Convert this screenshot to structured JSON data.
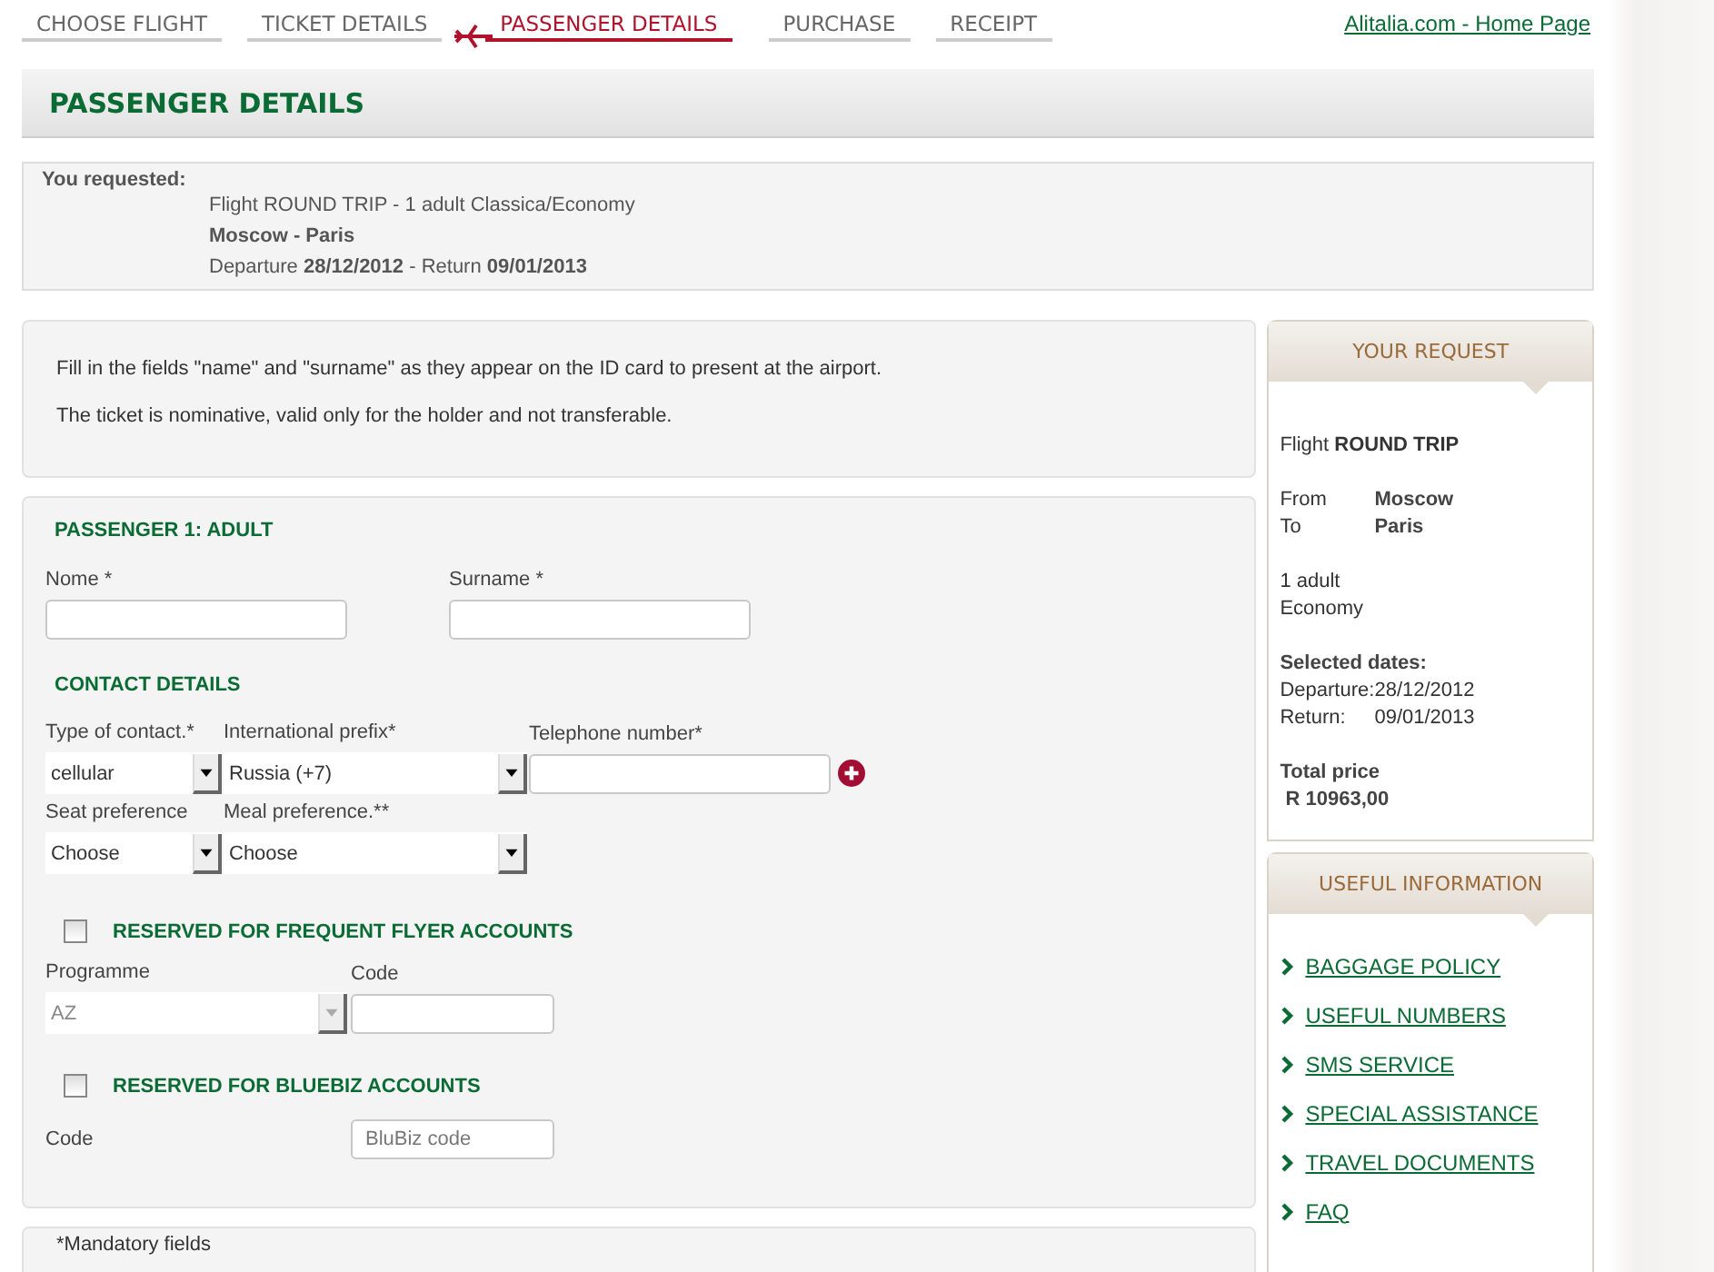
{
  "steps": [
    {
      "label": "CHOOSE FLIGHT",
      "selected": false
    },
    {
      "label": "TICKET DETAILS",
      "selected": false
    },
    {
      "label": "PASSENGER DETAILS",
      "selected": true
    },
    {
      "label": "PURCHASE",
      "selected": false
    },
    {
      "label": "RECEIPT",
      "selected": false
    }
  ],
  "home_link": "Alitalia.com - Home Page",
  "page_title": "PASSENGER DETAILS",
  "request_summary": {
    "heading": "You requested:",
    "lines": [
      "Flight ROUND TRIP - 1 adult  Classica/Economy",
      "**Moscow - Paris**",
      "Departure **28/12/2012** - Return **09/01/2013**"
    ]
  },
  "notice": [
    "Fill in the fields \"name\" and \"surname\" as they appear on the ID card to present at the airport.",
    "The ticket is nominative, valid only for the holder and not transferable."
  ],
  "passenger": {
    "title": "PASSENGER 1: ADULT",
    "name_label": "Nome *",
    "surname_label": "Surname *",
    "contact_title": "CONTACT DETAILS",
    "contact_type": {
      "label": "Type of contact.*",
      "value": "cellular"
    },
    "prefix": {
      "label": "International prefix*",
      "value": "Russia (+7)"
    },
    "phone": {
      "label": "Telephone number*"
    },
    "seat": {
      "label": "Seat preference",
      "value": "Choose"
    },
    "meal": {
      "label": "Meal preference.**",
      "value": "Choose"
    },
    "frequent_flyer": {
      "title": "RESERVED FOR FREQUENT FLYER ACCOUNTS",
      "checked": false,
      "programme_label": "Programme",
      "programme": "AZ",
      "programme_disabled": true,
      "code_label": "Code"
    },
    "bluebiz": {
      "title": "RESERVED FOR BLUEBIZ ACCOUNTS",
      "checked": false,
      "code_label": "Code",
      "code_placeholder": "BluBiz code"
    }
  },
  "footer_note": "*Mandatory fields",
  "your_request": {
    "title": "YOUR REQUEST",
    "flight": "Flight **ROUND TRIP**",
    "from_label": "From",
    "from": "Moscow",
    "to_label": "To",
    "to": "Paris",
    "passengers": "1 adult",
    "cabin": "Economy",
    "dates_title": "Selected dates:",
    "departure_label": "Departure:",
    "departure": "28/12/2012",
    "return_label": "Return:",
    "return": "09/01/2013",
    "price_title": "Total price",
    "price": "R 10963,00"
  },
  "useful_info": {
    "title": "USEFUL INFORMATION",
    "links": [
      "BAGGAGE POLICY",
      "USEFUL NUMBERS",
      "SMS SERVICE",
      "SPECIAL ASSISTANCE",
      "TRAVEL DOCUMENTS",
      "FAQ"
    ]
  }
}
